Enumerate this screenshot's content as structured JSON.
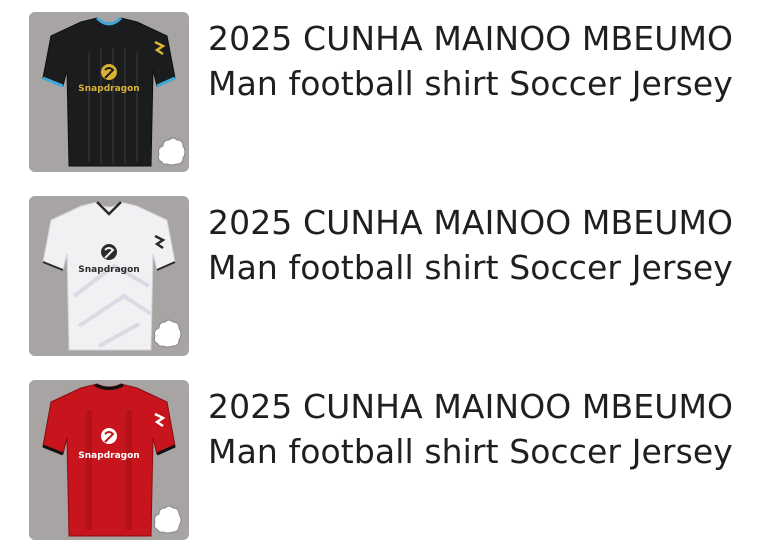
{
  "products": [
    {
      "title_line1": "2025 CUNHA MAINOO MBEUMO",
      "title_line2": "Man football shirt Soccer Jersey",
      "kit": "third",
      "shirt_color": "#1b1c1d",
      "trim_color": "#c9a227",
      "sponsor": "Snapdragon",
      "sponsor_color": "#d9b234"
    },
    {
      "title_line1": "2025 CUNHA MAINOO MBEUMO",
      "title_line2": "Man football shirt Soccer Jersey",
      "kit": "away",
      "shirt_color": "#f1f1f4",
      "trim_color": "#2a2a2a",
      "sponsor": "Snapdragon",
      "sponsor_color": "#2b2b2b"
    },
    {
      "title_line1": "2025 CUNHA MAINOO MBEUMO",
      "title_line2": "Man football shirt Soccer Jersey",
      "kit": "home",
      "shirt_color": "#c8141c",
      "trim_color": "#111111",
      "sponsor": "Snapdragon",
      "sponsor_color": "#ffffff"
    }
  ],
  "icons": {
    "thumbnail_badge": "lamb-icon",
    "logo": "snapdragon-logo-icon"
  }
}
